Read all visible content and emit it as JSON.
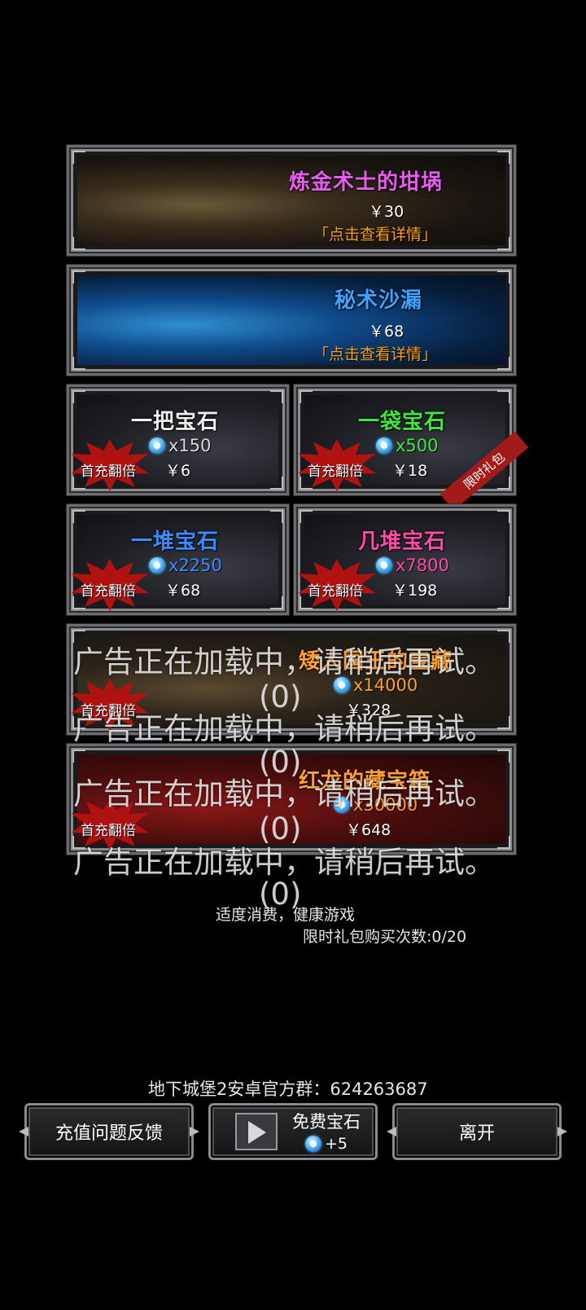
{
  "offers": {
    "alchemist": {
      "title": "炼金术士的坩埚",
      "price": "￥30",
      "detail": "「点击查看详情」",
      "title_color": "#e85cf0"
    },
    "hourglass": {
      "title": "秘术沙漏",
      "price": "￥68",
      "detail": "「点击查看详情」",
      "title_color": "#3fa2ff"
    }
  },
  "gems": [
    {
      "title": "一把宝石",
      "amount": "x150",
      "price": "￥6",
      "badge": "首充翻倍",
      "title_color": "#f0f0f0",
      "amount_color": "#d8d8d8"
    },
    {
      "title": "一袋宝石",
      "amount": "x500",
      "price": "￥18",
      "badge": "首充翻倍",
      "ribbon": "限时礼包",
      "title_color": "#3ee83e",
      "amount_color": "#3ee83e"
    },
    {
      "title": "一堆宝石",
      "amount": "x2250",
      "price": "￥68",
      "badge": "首充翻倍",
      "title_color": "#3a8cff",
      "amount_color": "#3a8cff"
    },
    {
      "title": "几堆宝石",
      "amount": "x7800",
      "price": "￥198",
      "badge": "首充翻倍",
      "title_color": "#ff4aa8",
      "amount_color": "#ff4aa8"
    }
  ],
  "chests": [
    {
      "title": "矮人国王的宝藏",
      "amount": "x14000",
      "price": "￥328",
      "badge": "首充翻倍",
      "title_color": "#ffa030",
      "amount_color": "#ffa030"
    },
    {
      "title": "红龙的藏宝箱",
      "amount": "x30000",
      "price": "￥648",
      "badge": "首充翻倍",
      "title_color": "#ffa030",
      "amount_color": "#ffa030"
    }
  ],
  "ad_overlay": {
    "message": "广告正在加载中，请稍后再试。",
    "count": "(0)"
  },
  "footer": {
    "moderate": "适度消费，健康游戏",
    "limit": "限时礼包购买次数:0/20",
    "group": "地下城堡2安卓官方群：624263687"
  },
  "buttons": {
    "feedback": "充值问题反馈",
    "free_gems": "免费宝石",
    "free_gems_amount": "+5",
    "leave": "离开"
  }
}
